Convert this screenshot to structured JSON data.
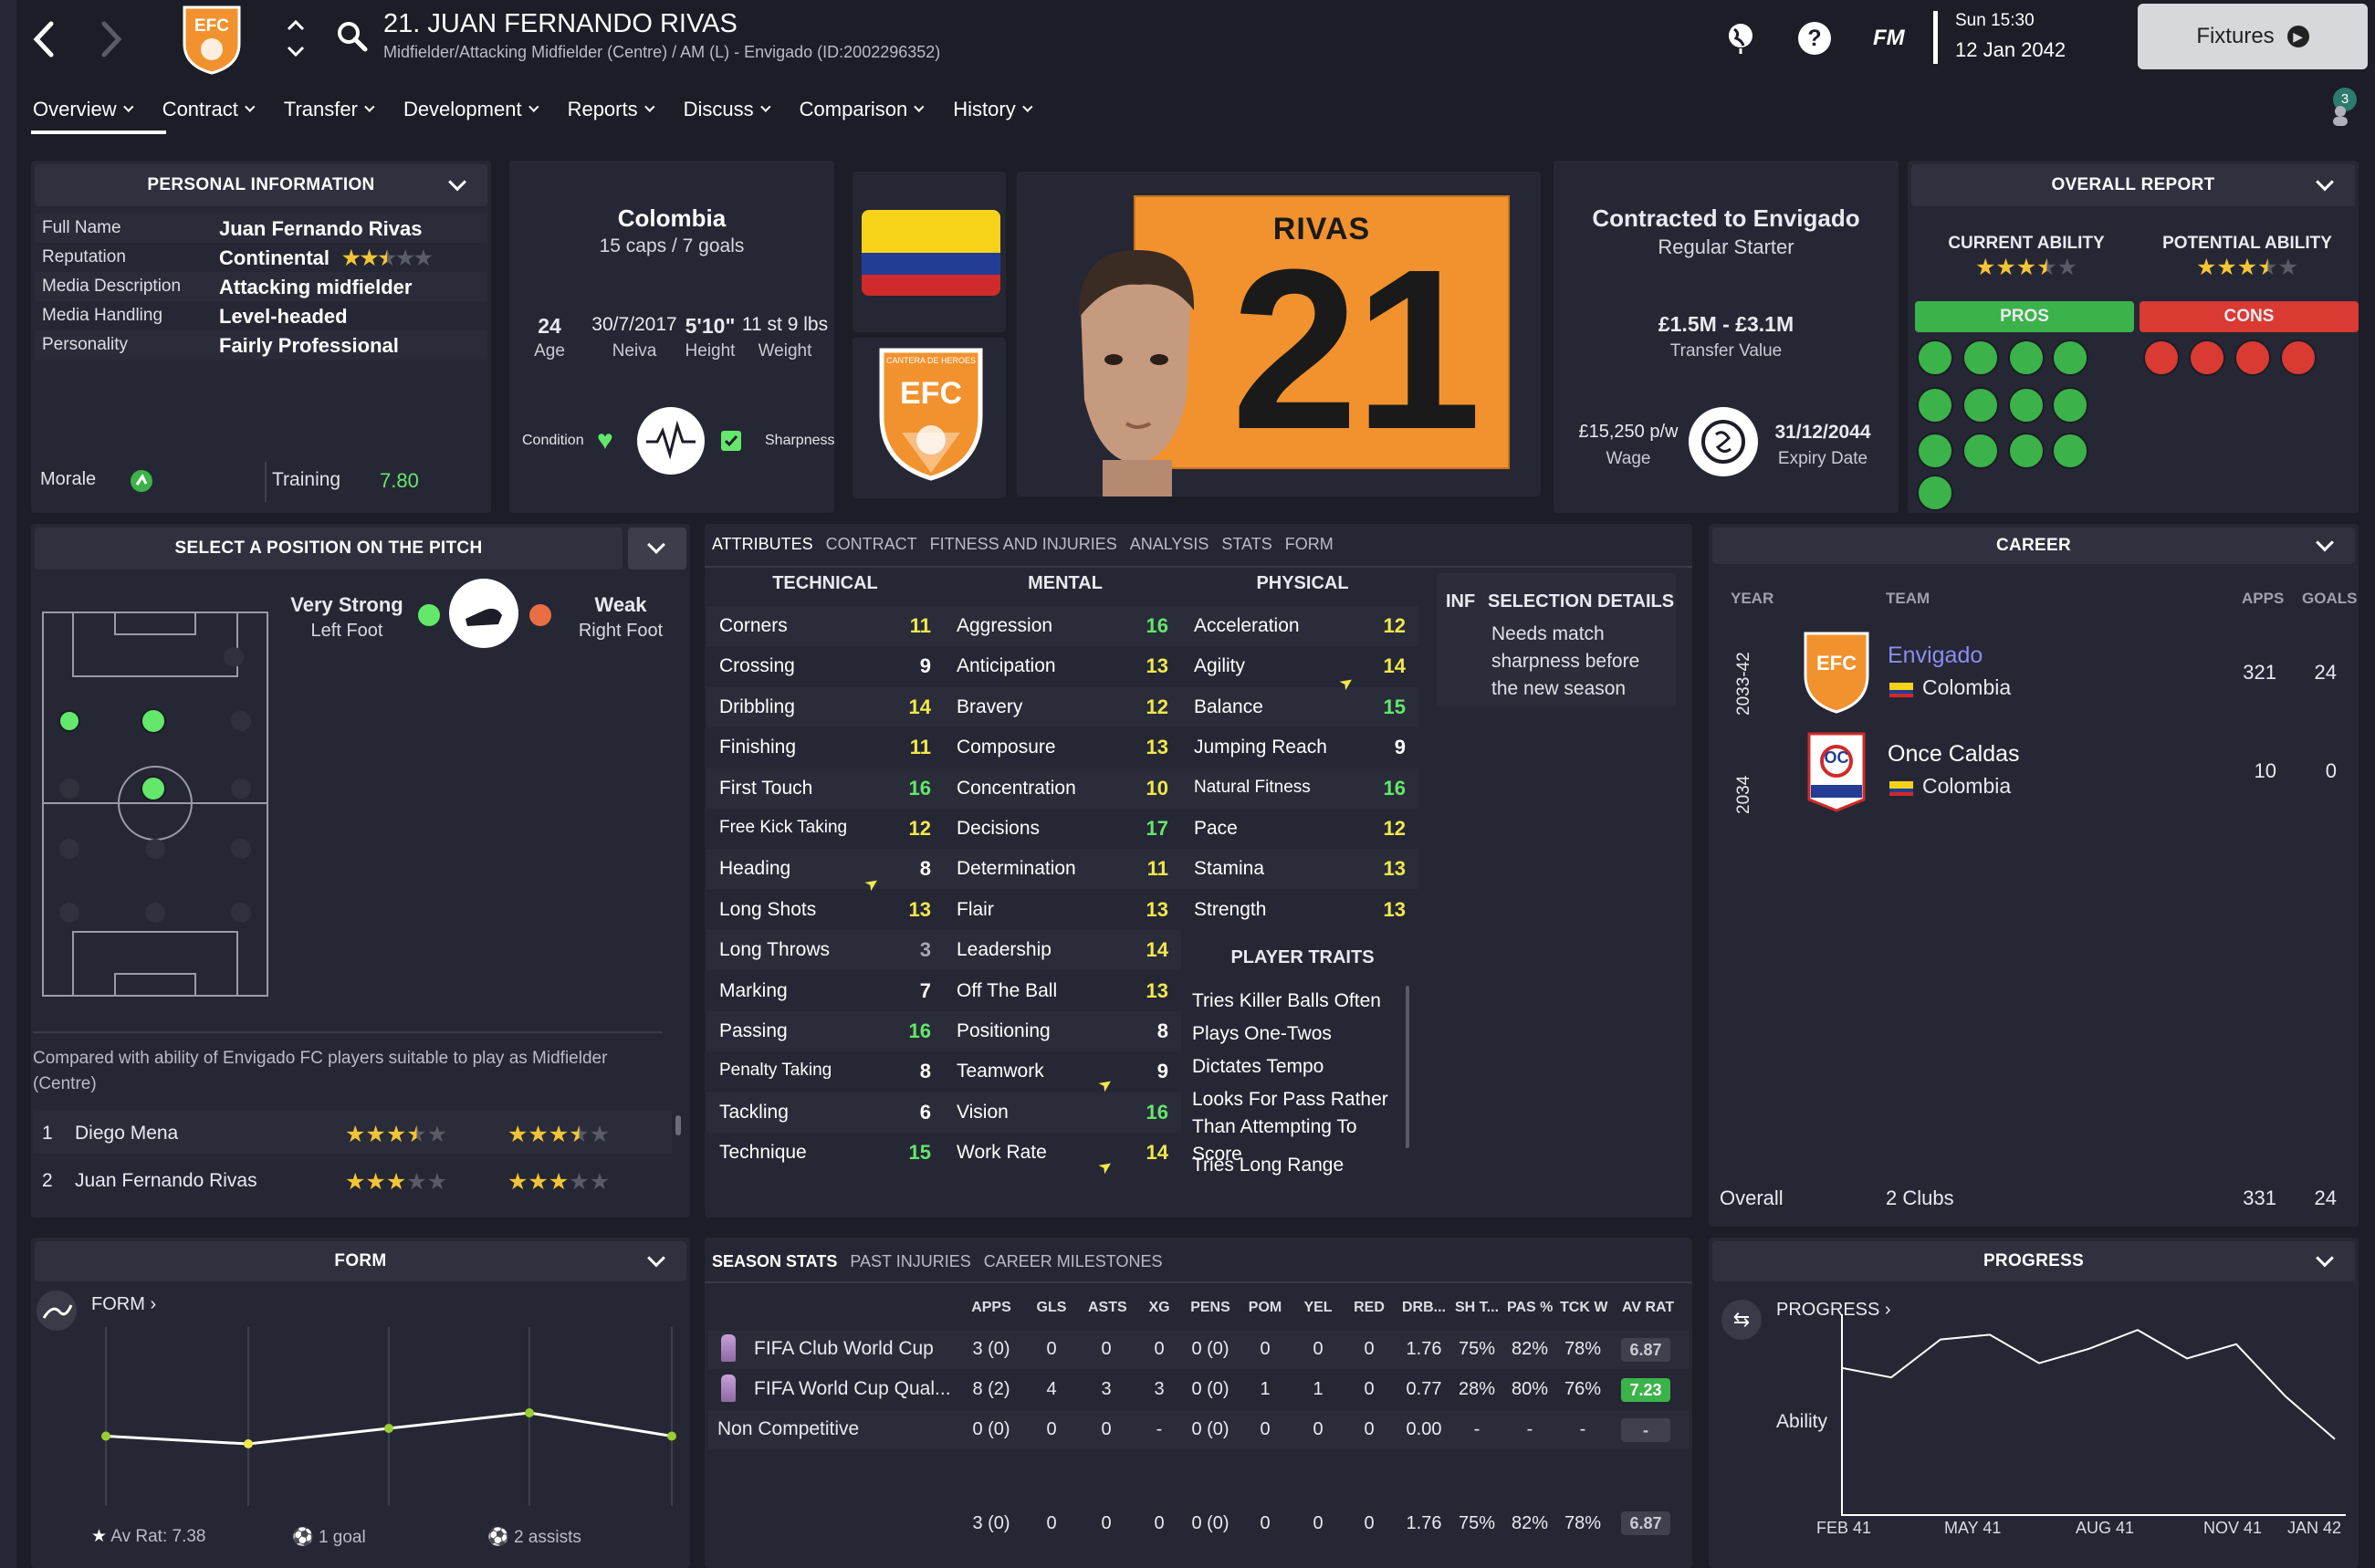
{
  "header": {
    "player_title": "21. JUAN FERNANDO RIVAS",
    "subtitle": "Midfielder/Attacking Midfielder (Centre) / AM (L) - Envigado (ID:2002296352)",
    "day_time": "Sun 15:30",
    "date": "12 Jan 2042",
    "fixtures_label": "Fixtures",
    "fm_label": "FM",
    "help": "?",
    "notif_count": "3",
    "club_badge": "EFC"
  },
  "nav": [
    "Overview",
    "Contract",
    "Transfer",
    "Development",
    "Reports",
    "Discuss",
    "Comparison",
    "History"
  ],
  "personal": {
    "title": "PERSONAL INFORMATION",
    "rows": [
      {
        "label": "Full Name",
        "value": "Juan Fernando Rivas"
      },
      {
        "label": "Reputation",
        "value": "Continental"
      },
      {
        "label": "Media Description",
        "value": "Attacking midfielder"
      },
      {
        "label": "Media Handling",
        "value": "Level-headed"
      },
      {
        "label": "Personality",
        "value": "Fairly Professional"
      }
    ],
    "morale_label": "Morale",
    "training_label": "Training",
    "training_value": "7.80",
    "reputation_stars": 2.5
  },
  "nation": {
    "name": "Colombia",
    "caps": "15 caps / 7 goals",
    "age": "24",
    "age_label": "Age",
    "dob": "30/7/2017",
    "birthplace": "Neiva",
    "height": "5'10\"",
    "height_label": "Height",
    "weight": "11 st 9 lbs",
    "weight_label": "Weight",
    "condition_label": "Condition",
    "sharpness_label": "Sharpness"
  },
  "kit": {
    "name": "RIVAS",
    "number": "21",
    "badge": "EFC",
    "badge_ring": "CANTERA DE HEROES"
  },
  "contract": {
    "title": "Contracted to Envigado",
    "role": "Regular Starter",
    "value": "£1.5M - £3.1M",
    "value_label": "Transfer Value",
    "wage": "£15,250 p/w",
    "wage_label": "Wage",
    "expiry": "31/12/2044",
    "expiry_label": "Expiry Date"
  },
  "report": {
    "title": "OVERALL REPORT",
    "ca_label": "CURRENT ABILITY",
    "pa_label": "POTENTIAL ABILITY",
    "ca_stars": 3.5,
    "pa_stars": 3.5,
    "pros": "PROS",
    "cons": "CONS"
  },
  "position": {
    "title": "SELECT A POSITION ON THE PITCH",
    "left_foot": "Very Strong",
    "left_label": "Left Foot",
    "right_foot": "Weak",
    "right_label": "Right Foot",
    "compare_text": "Compared with ability of Envigado FC players suitable to play as Midfielder (Centre)",
    "compare": [
      {
        "rank": "1",
        "name": "Diego Mena",
        "ca": 3.5,
        "pa": 3.5
      },
      {
        "rank": "2",
        "name": "Juan Fernando Rivas",
        "ca": 3,
        "pa": 3
      }
    ]
  },
  "attr_tabs": [
    "ATTRIBUTES",
    "CONTRACT",
    "FITNESS AND INJURIES",
    "ANALYSIS",
    "STATS",
    "FORM"
  ],
  "technical": {
    "title": "TECHNICAL",
    "items": [
      [
        "Corners",
        "11"
      ],
      [
        "Crossing",
        "9"
      ],
      [
        "Dribbling",
        "14"
      ],
      [
        "Finishing",
        "11"
      ],
      [
        "First Touch",
        "16"
      ],
      [
        "Free Kick Taking",
        "12"
      ],
      [
        "Heading",
        "8"
      ],
      [
        "Long Shots",
        "13"
      ],
      [
        "Long Throws",
        "3"
      ],
      [
        "Marking",
        "7"
      ],
      [
        "Passing",
        "16"
      ],
      [
        "Penalty Taking",
        "8"
      ],
      [
        "Tackling",
        "6"
      ],
      [
        "Technique",
        "15"
      ]
    ]
  },
  "mental": {
    "title": "MENTAL",
    "items": [
      [
        "Aggression",
        "16"
      ],
      [
        "Anticipation",
        "13"
      ],
      [
        "Bravery",
        "12"
      ],
      [
        "Composure",
        "13"
      ],
      [
        "Concentration",
        "10"
      ],
      [
        "Decisions",
        "17"
      ],
      [
        "Determination",
        "11"
      ],
      [
        "Flair",
        "13"
      ],
      [
        "Leadership",
        "14"
      ],
      [
        "Off The Ball",
        "13"
      ],
      [
        "Positioning",
        "8"
      ],
      [
        "Teamwork",
        "9"
      ],
      [
        "Vision",
        "16"
      ],
      [
        "Work Rate",
        "14"
      ]
    ]
  },
  "physical": {
    "title": "PHYSICAL",
    "items": [
      [
        "Acceleration",
        "12"
      ],
      [
        "Agility",
        "14"
      ],
      [
        "Balance",
        "15"
      ],
      [
        "Jumping Reach",
        "9"
      ],
      [
        "Natural Fitness",
        "16"
      ],
      [
        "Pace",
        "12"
      ],
      [
        "Stamina",
        "13"
      ],
      [
        "Strength",
        "13"
      ]
    ]
  },
  "traits": {
    "title": "PLAYER TRAITS",
    "items": [
      "Tries Killer Balls Often",
      "Plays One-Twos",
      "Dictates Tempo",
      "Looks For Pass Rather Than Attempting To Score",
      "Tries Long Range Passes"
    ]
  },
  "selection": {
    "inf": "INF",
    "title": "SELECTION DETAILS",
    "text": "Needs match sharpness before the new season"
  },
  "career": {
    "title": "CAREER",
    "cols": [
      "YEAR",
      "TEAM",
      "APPS",
      "GOALS"
    ],
    "rows": [
      {
        "year": "2033-42",
        "team": "Envigado",
        "nation": "Colombia",
        "apps": "321",
        "goals": "24",
        "badge": "EFC"
      },
      {
        "year": "2034",
        "team": "Once Caldas",
        "nation": "Colombia",
        "apps": "10",
        "goals": "0",
        "badge": "OC"
      }
    ],
    "total_label": "Overall",
    "total_clubs": "2 Clubs",
    "total_apps": "331",
    "total_goals": "24"
  },
  "form": {
    "title": "FORM",
    "link": "FORM",
    "avrat": "Av Rat: 7.38",
    "goals": "1 goal",
    "assists": "2 assists",
    "points": [
      6.9,
      6.8,
      7.0,
      7.2,
      6.9
    ]
  },
  "stats": {
    "tabs": [
      "SEASON STATS",
      "PAST INJURIES",
      "CAREER MILESTONES"
    ],
    "cols": [
      "APPS",
      "GLS",
      "ASTS",
      "XG",
      "PENS",
      "POM",
      "YEL",
      "RED",
      "DRB...",
      "SH T...",
      "PAS %",
      "TCK W",
      "AV RAT"
    ],
    "rows": [
      {
        "comp": "FIFA Club World Cup",
        "v": [
          "3 (0)",
          "0",
          "0",
          "0",
          "0 (0)",
          "0",
          "0",
          "0",
          "1.76",
          "75%",
          "82%",
          "78%"
        ],
        "rat": "6.87",
        "ratgreen": false
      },
      {
        "comp": "FIFA World Cup Qual...",
        "v": [
          "8 (2)",
          "4",
          "3",
          "3",
          "0 (0)",
          "1",
          "1",
          "0",
          "0.77",
          "28%",
          "80%",
          "76%"
        ],
        "rat": "7.23",
        "ratgreen": true
      },
      {
        "comp": "Non Competitive",
        "v": [
          "0 (0)",
          "0",
          "0",
          "-",
          "0 (0)",
          "0",
          "0",
          "0",
          "0.00",
          "-",
          "-",
          "-"
        ],
        "rat": "-",
        "ratgreen": false
      }
    ],
    "total": [
      "3 (0)",
      "0",
      "0",
      "0",
      "0 (0)",
      "0",
      "0",
      "0",
      "1.76",
      "75%",
      "82%",
      "78%"
    ],
    "total_rat": "6.87"
  },
  "progress": {
    "title": "PROGRESS",
    "link": "PROGRESS",
    "ylabel": "Ability",
    "xlabels": [
      "FEB 41",
      "MAY 41",
      "AUG 41",
      "NOV 41",
      "JAN 42"
    ],
    "points": [
      62,
      58,
      74,
      76,
      64,
      70,
      78,
      66,
      72,
      50,
      32
    ]
  },
  "colors": {
    "panel": "#262734",
    "header": "#30313f",
    "accent_yellow": "#f1e94a",
    "accent_green": "#63e86b",
    "pros": "#3bb34a",
    "cons": "#d93a32",
    "flag_yellow": "#f6d318",
    "flag_blue": "#233d95",
    "flag_red": "#d02a2b",
    "kit_orange": "#f2922e"
  }
}
